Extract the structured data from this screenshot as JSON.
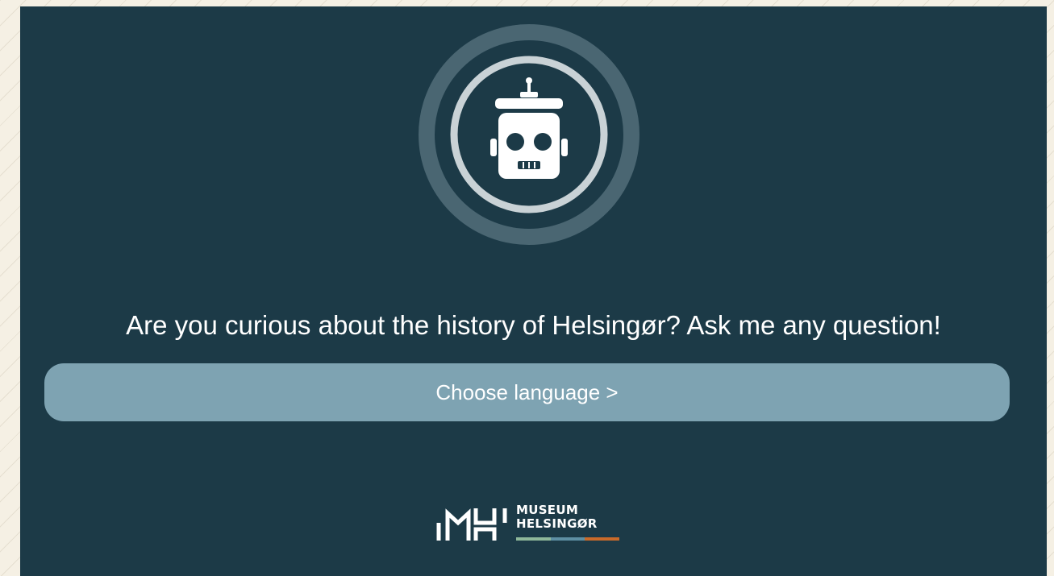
{
  "chat_intro": {
    "question": "Are you curious about the history of Helsingør? Ask me any question!",
    "choose_language_label": "Choose language >"
  },
  "assistant_avatar": {
    "icon": "robot-icon"
  },
  "logo": {
    "line1": "MUSEUM",
    "line2": "HELSINGØR",
    "stripe_colors": [
      "#8fb89a",
      "#5e8fa3",
      "#c96a2a"
    ]
  },
  "colors": {
    "panel_background": "#1c3a47",
    "button_background": "#7ea3b2",
    "page_background": "#f5f0e4",
    "text": "#ffffff"
  }
}
